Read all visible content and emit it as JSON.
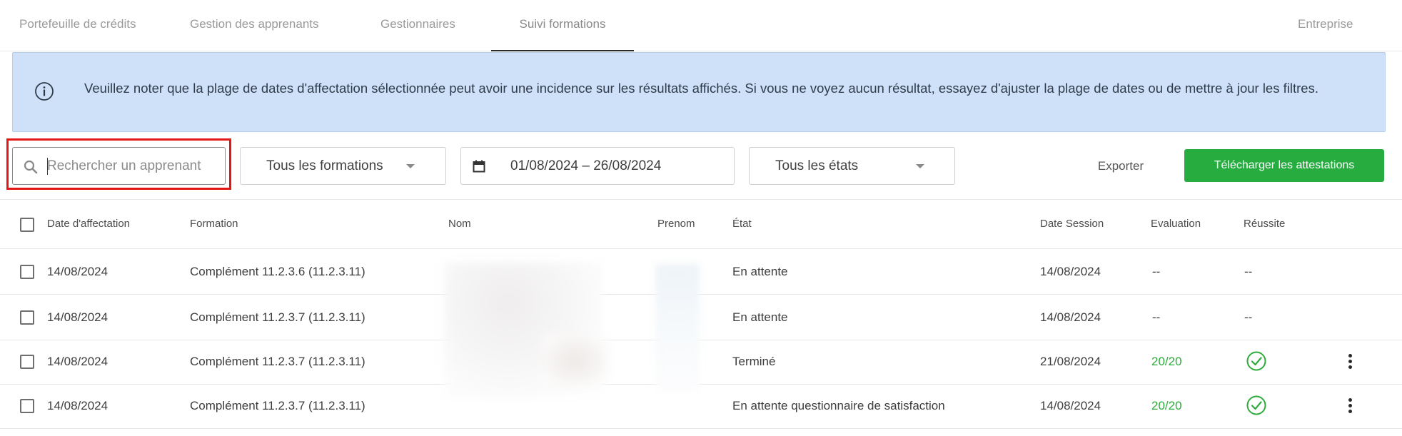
{
  "tabs": [
    {
      "label": "Portefeuille de crédits",
      "active": false
    },
    {
      "label": "Gestion des apprenants",
      "active": false
    },
    {
      "label": "Gestionnaires",
      "active": false
    },
    {
      "label": "Suivi formations",
      "active": true
    }
  ],
  "company_tab": "Entreprise",
  "banner": {
    "icon": "info-icon",
    "text": "Veuillez noter que la plage de dates d'affectation sélectionnée peut avoir une incidence sur les résultats affichés. Si vous ne voyez aucun résultat, essayez d'ajuster la plage de dates ou de mettre à jour les filtres."
  },
  "filters": {
    "search_placeholder": "Rechercher un apprenant",
    "search_value": "",
    "formations_select": "Tous les formations",
    "date_range": "01/08/2024 – 26/08/2024",
    "states_select": "Tous les états",
    "export_label": "Exporter",
    "download_label": "Télécharger les attestations"
  },
  "table": {
    "headers": {
      "date_affectation": "Date d'affectation",
      "formation": "Formation",
      "nom": "Nom",
      "prenom": "Prenom",
      "etat": "État",
      "date_session": "Date Session",
      "evaluation": "Evaluation",
      "reussite": "Réussite"
    },
    "rows": [
      {
        "date_affectation": "14/08/2024",
        "formation": "Complément 11.2.3.6 (11.2.3.11)",
        "etat": "En attente",
        "date_session": "14/08/2024",
        "evaluation": "--",
        "reussite": "--"
      },
      {
        "date_affectation": "14/08/2024",
        "formation": "Complément 11.2.3.7 (11.2.3.11)",
        "etat": "En attente",
        "date_session": "14/08/2024",
        "evaluation": "--",
        "reussite": "--"
      },
      {
        "date_affectation": "14/08/2024",
        "formation": "Complément 11.2.3.7 (11.2.3.11)",
        "etat": "Terminé",
        "date_session": "21/08/2024",
        "evaluation": "20/20",
        "reussite": "check-circle-icon"
      },
      {
        "date_affectation": "14/08/2024",
        "formation": "Complément 11.2.3.7 (11.2.3.11)",
        "etat": "En attente questionnaire de satisfaction",
        "date_session": "14/08/2024",
        "evaluation": "20/20",
        "reussite": "check-circle-icon"
      }
    ]
  },
  "colors": {
    "accent_green": "#27ad3f",
    "pass_green": "#2faa3c",
    "banner_bg": "#cfe1f9",
    "highlight_red": "#e51616"
  }
}
